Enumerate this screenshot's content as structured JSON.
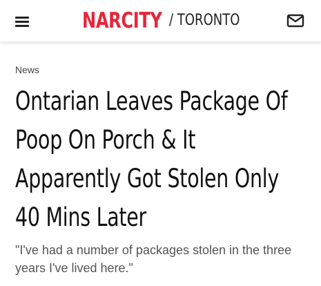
{
  "header": {
    "menu_icon": "hamburger-menu-icon",
    "logo": "NARCITY",
    "city": "/ TORONTO",
    "mail_icon": "mail-icon",
    "brand_color": "#e6263a"
  },
  "article": {
    "category": "News",
    "headline_lines": [
      "Ontarian Leaves Package Of",
      "Poop On Porch & It",
      "Apparently Got Stolen Only",
      "40 Mins Later"
    ],
    "subhead": "\"I've had a number of packages stolen in the three years I've lived here.\""
  }
}
